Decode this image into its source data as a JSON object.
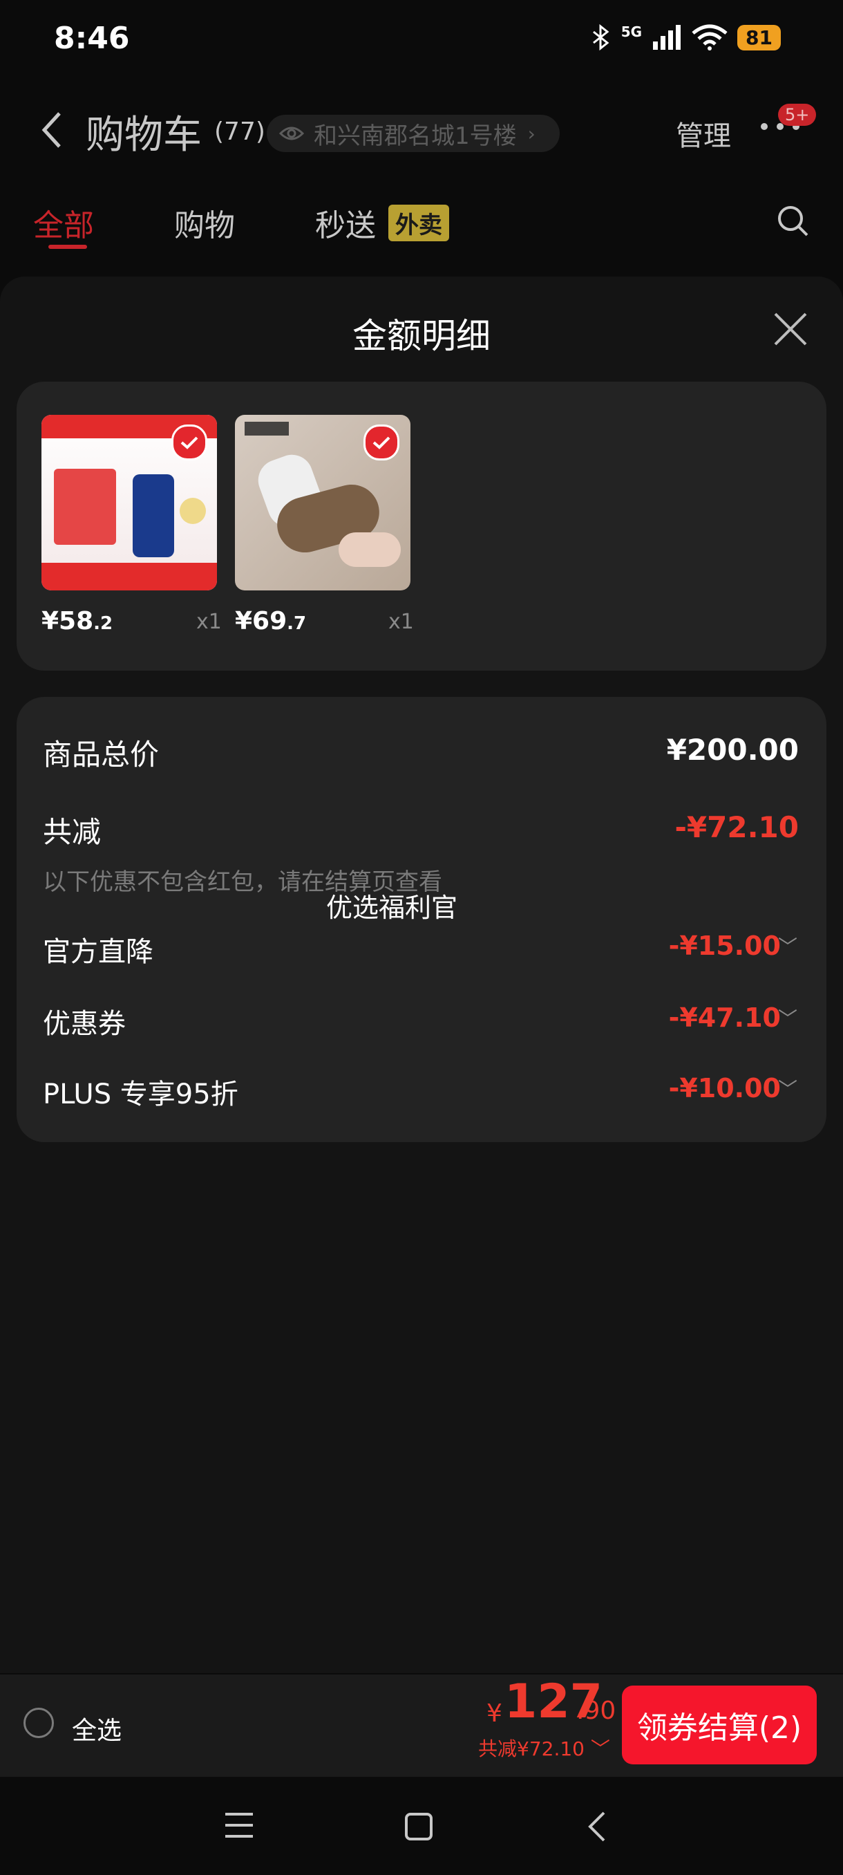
{
  "status_bar": {
    "time": "8:46",
    "network": "5G",
    "battery": "81"
  },
  "header": {
    "title": "购物车",
    "count": "(77)",
    "address": "和兴南郡名城1号楼",
    "manage": "管理",
    "more_badge": "5+"
  },
  "tabs": [
    {
      "label": "全部"
    },
    {
      "label": "购物"
    },
    {
      "label": "秒送"
    }
  ],
  "tab_tag": "外卖",
  "sheet": {
    "title": "金额明细"
  },
  "products": [
    {
      "price_int": "¥58",
      "price_dec": ".2",
      "qty": "x1",
      "image": "health-supplement-product-image"
    },
    {
      "price_int": "¥69",
      "price_dec": ".7",
      "qty": "x1",
      "image": "fur-loafer-shoe-product-image"
    }
  ],
  "breakdown": {
    "total_label": "商品总价",
    "total_value": "¥200.00",
    "discount_label": "共减",
    "discount_value": "-¥72.10",
    "note": "以下优惠不包含红包，请在结算页查看",
    "overlay": "优选福利官",
    "items": [
      {
        "label": "官方直降",
        "value": "-¥15.00"
      },
      {
        "label": "优惠券",
        "value": "-¥47.10"
      },
      {
        "label": "PLUS 专享95折",
        "value": "-¥10.00"
      }
    ]
  },
  "bottom": {
    "select_all": "全选",
    "currency": "¥",
    "total_int": "127",
    "total_dec": ".90",
    "saved": "共减¥72.10",
    "checkout": "领券结算(2)"
  },
  "colors": {
    "accent_red": "#ee3a2e",
    "button_red": "#f5162c",
    "tag_gold": "#b8a032"
  }
}
